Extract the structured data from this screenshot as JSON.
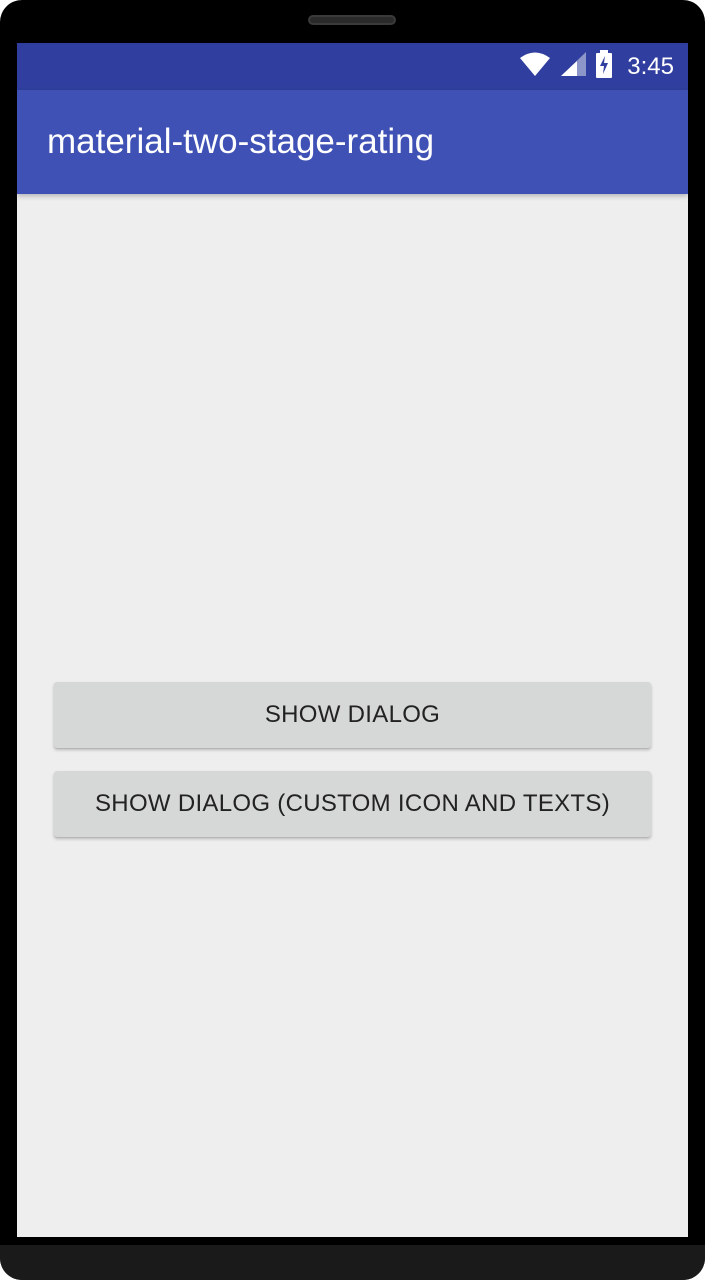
{
  "status_bar": {
    "time": "3:45",
    "icons": [
      "wifi-icon",
      "cell-signal-icon",
      "battery-charging-icon"
    ]
  },
  "app_bar": {
    "title": "material-two-stage-rating"
  },
  "main": {
    "buttons": [
      {
        "label": "SHOW DIALOG"
      },
      {
        "label": "SHOW DIALOG (CUSTOM ICON AND TEXTS)"
      }
    ]
  },
  "colors": {
    "status_bar": "#303f9f",
    "app_bar": "#3f51b5",
    "background": "#eeeeee",
    "button": "#d6d7d7"
  }
}
